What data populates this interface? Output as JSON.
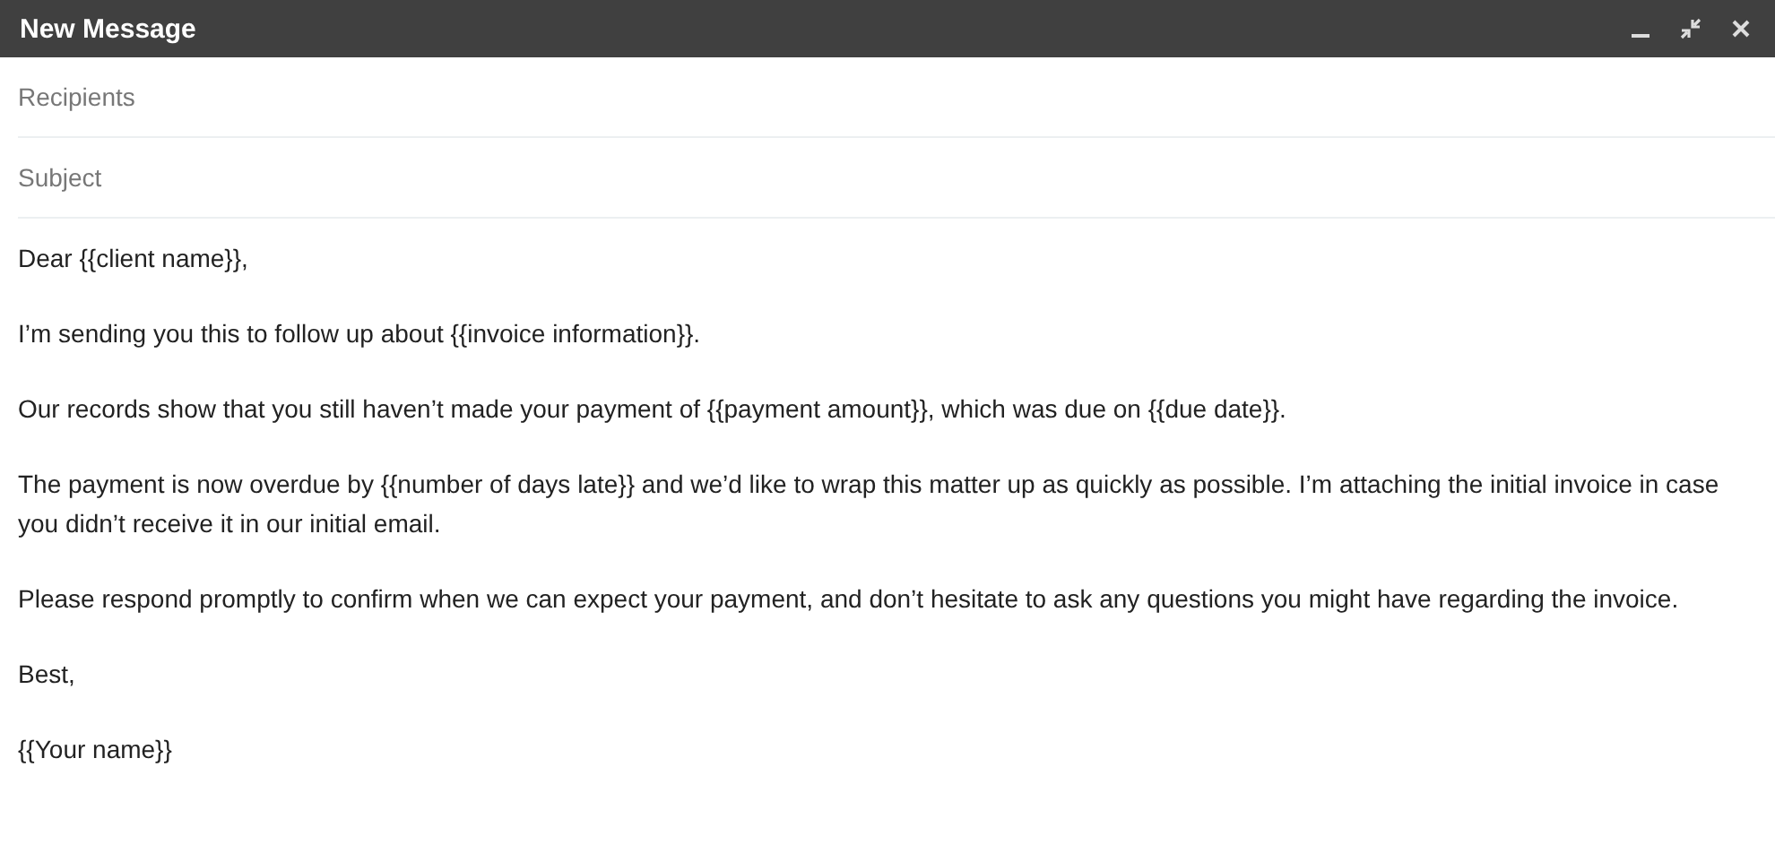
{
  "window": {
    "title": "New Message"
  },
  "recipients": {
    "placeholder": "Recipients"
  },
  "subject": {
    "placeholder": "Subject"
  },
  "body": {
    "paragraphs": [
      "Dear {{client name}},",
      "I’m sending you this to follow up about {{invoice information}}.",
      "Our records show that you still haven’t made your payment of {{payment amount}}, which was due on {{due date}}.",
      "The payment is now overdue by {{number of days late}} and we’d like to wrap this matter up as quickly as possible. I’m attaching the initial invoice in case you didn’t receive it in our initial email.",
      "Please respond promptly to confirm when we can expect your payment, and don’t hesitate to ask any questions you might have regarding the invoice.",
      "Best,",
      "{{Your name}}"
    ]
  }
}
